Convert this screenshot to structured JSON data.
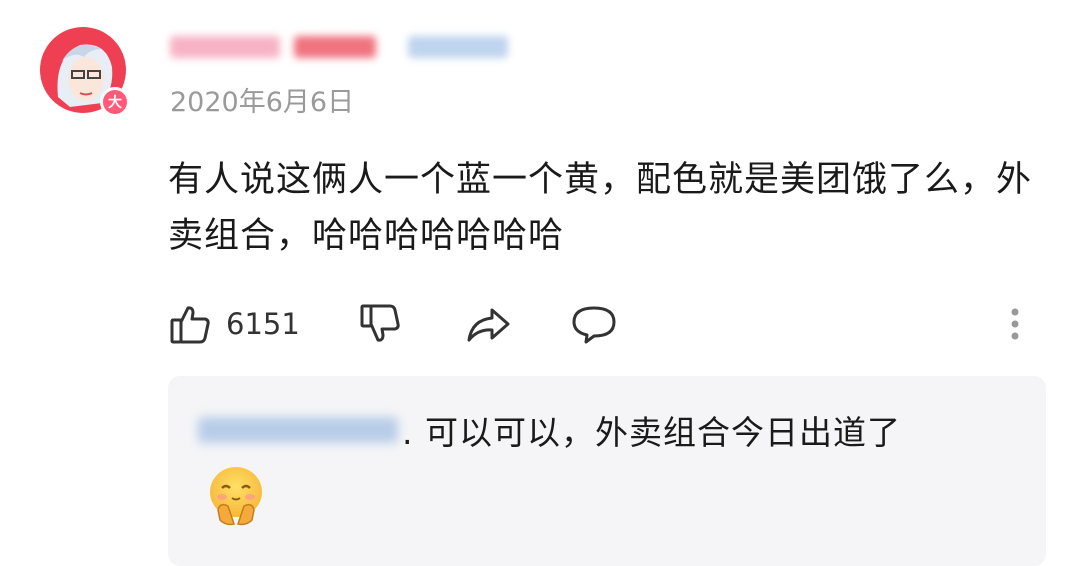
{
  "comment": {
    "date": "2020年6月6日",
    "level_badge": "大",
    "text": "有人说这俩人一个蓝一个黄，配色就是美团饿了么，外卖组合，哈哈哈哈哈哈哈",
    "likes": "6151"
  },
  "reply": {
    "text": ". 可以可以，外卖组合今日出道了"
  },
  "icons": [
    "thumbs-up-icon",
    "thumbs-down-icon",
    "share-icon",
    "comment-icon",
    "more-vertical-icon"
  ],
  "colors": {
    "avatar_bg": "#ef3f52",
    "badge": "#ff5a78",
    "reply_bg": "#f5f5f7"
  }
}
